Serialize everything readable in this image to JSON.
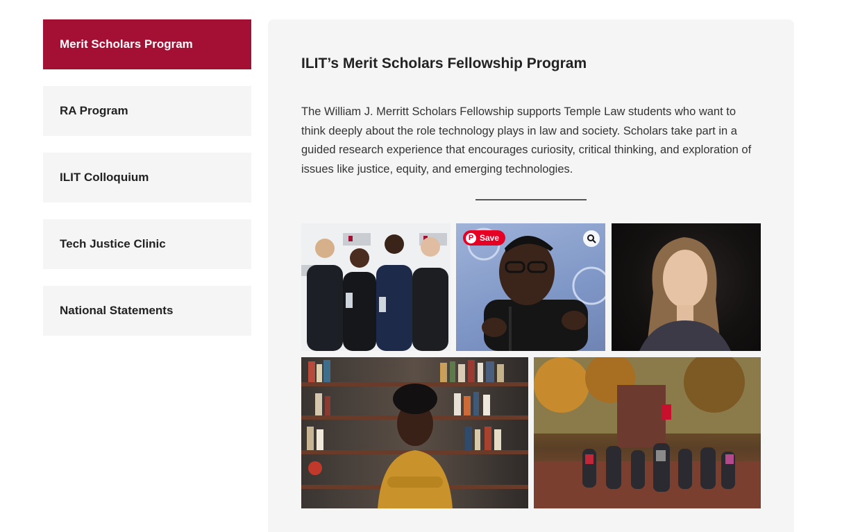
{
  "sidebar": {
    "items": [
      {
        "label": "Merit Scholars Program",
        "active": true
      },
      {
        "label": "RA Program",
        "active": false
      },
      {
        "label": "ILIT Colloquium",
        "active": false
      },
      {
        "label": "Tech Justice Clinic",
        "active": false
      },
      {
        "label": "National Statements",
        "active": false
      }
    ]
  },
  "main": {
    "title": "ILIT’s Merit Scholars Fellowship Program",
    "description": "The William J. Merritt Scholars Fellowship supports Temple Law students who want to think deeply about the role technology plays in law and society. Scholars take part in a guided research experience that encourages curiosity, critical thinking, and exploration of issues like justice, equity, and emerging technologies.",
    "photos": {
      "save_label": "Save",
      "save_icon": "pinterest-icon",
      "zoom_icon": "visual-search-icon"
    }
  },
  "colors": {
    "accent": "#a41034",
    "panel_bg": "#f5f5f5",
    "pinterest_red": "#e60023"
  }
}
